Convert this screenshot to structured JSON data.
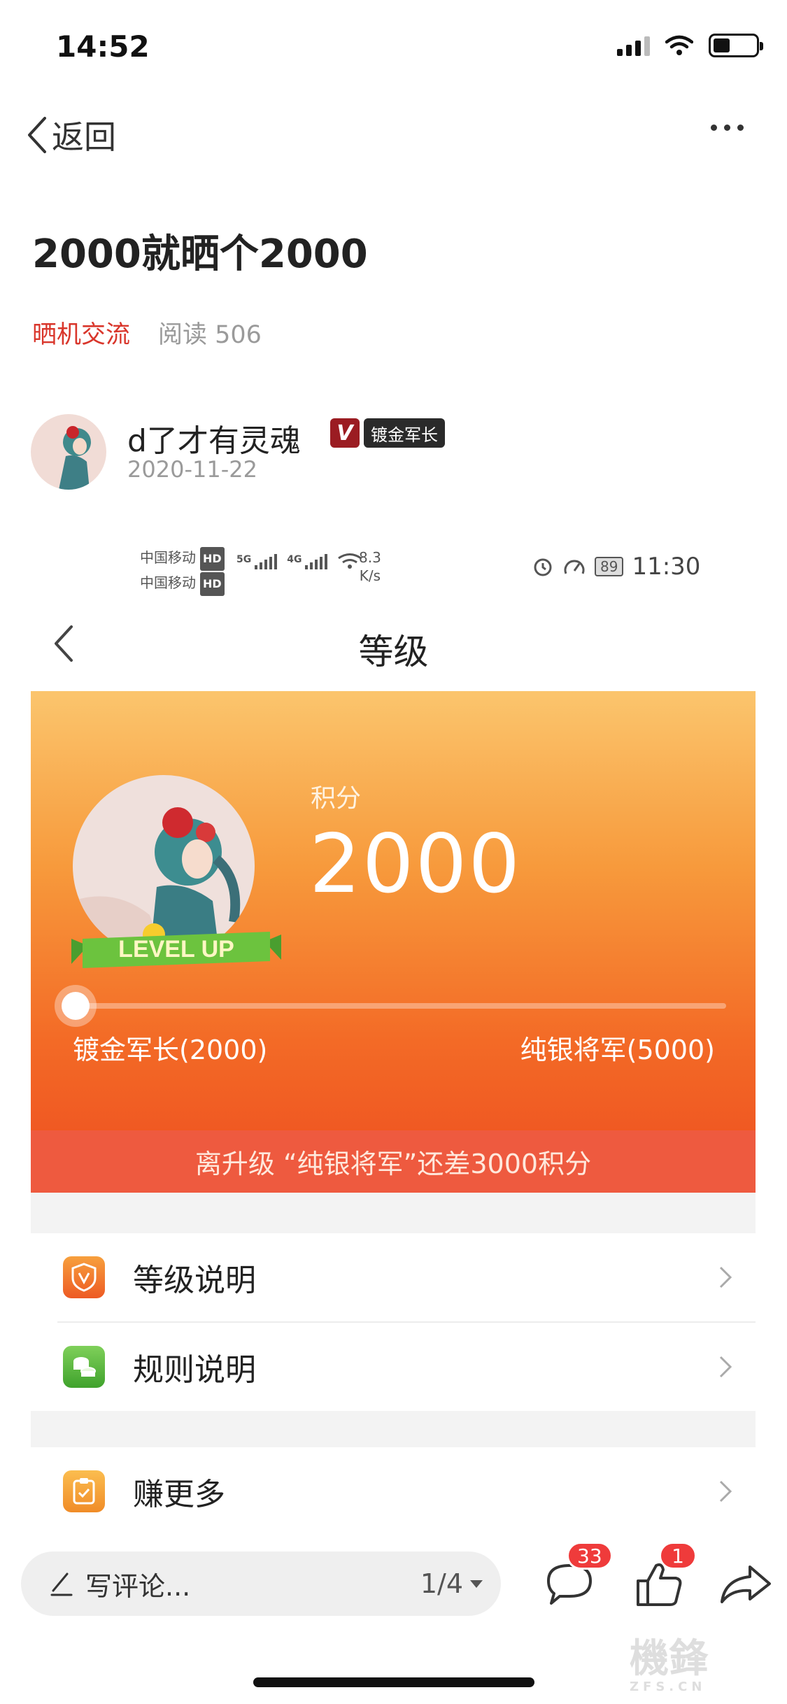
{
  "status_bar": {
    "time": "14:52"
  },
  "nav": {
    "back_label": "返回"
  },
  "post": {
    "title": "2000就晒个2000",
    "category": "晒机交流",
    "reads": "阅读 506",
    "author": "d了才有灵魂",
    "author_badge": "镀金军长",
    "date": "2020-11-22"
  },
  "embedded": {
    "status": {
      "carrier1": "中国移动",
      "carrier2": "中国移动",
      "hd": "HD",
      "net1": "5G",
      "net2": "4G",
      "speed_value": "8.3",
      "speed_unit": "K/s",
      "battery": "89",
      "time": "11:30"
    },
    "page_title": "等级",
    "level": {
      "points_label": "积分",
      "points": "2000",
      "ribbon": "LEVEL UP",
      "progress": 0.0,
      "current_level": "镀金军长(2000)",
      "next_level": "纯银将军(5000)",
      "gap_text": "离升级 “纯银将军”还差3000积分"
    },
    "menu": [
      {
        "label": "等级说明",
        "icon": "shield-v-icon",
        "color": "#f06a2a"
      },
      {
        "label": "规则说明",
        "icon": "coins-icon",
        "color": "#55b53d"
      },
      {
        "label": "赚更多",
        "icon": "clipboard-check-icon",
        "color": "#f5a23a"
      }
    ]
  },
  "bottom_bar": {
    "comment_placeholder": "写评论...",
    "page_indicator": "1/4",
    "comment_count": "33",
    "like_count": "1"
  },
  "watermark": {
    "text": "機鋒",
    "sub": "ZFS.CN"
  }
}
